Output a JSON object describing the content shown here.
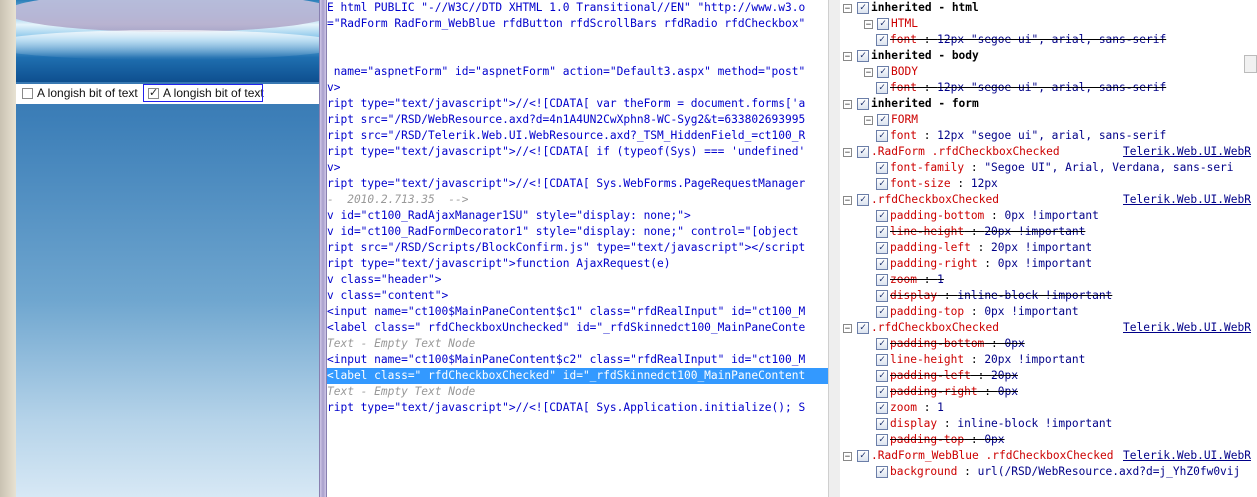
{
  "preview": {
    "checkbox1": {
      "label": "A longish bit of text",
      "checked": false
    },
    "checkbox2": {
      "label": "A longish bit of text",
      "checked": true
    }
  },
  "source_lines": [
    "E html PUBLIC \"-//W3C//DTD XHTML 1.0 Transitional//EN\" \"http://www.w3.o",
    "=\"RadForm RadForm_WebBlue rfdButton rfdScrollBars rfdRadio rfdCheckbox\"",
    "",
    "",
    " name=\"aspnetForm\" id=\"aspnetForm\" action=\"Default3.aspx\" method=\"post\"",
    "v>",
    "ript type=\"text/javascript\">//<![CDATA[ var theForm = document.forms['a",
    "ript src=\"/RSD/WebResource.axd?d=4n1A4UN2CwXphn8-WC-Syg2&t=633802693995",
    "ript src=\"/RSD/Telerik.Web.UI.WebResource.axd?_TSM_HiddenField_=ct100_R",
    "ript type=\"text/javascript\">//<![CDATA[ if (typeof(Sys) === 'undefined'",
    "v>",
    "ript type=\"text/javascript\">//<![CDATA[ Sys.WebForms.PageRequestManager",
    "-  2010.2.713.35  -->",
    "v id=\"ct100_RadAjaxManager1SU\" style=\"display: none;\">",
    "v id=\"ct100_RadFormDecorator1\" style=\"display: none;\" control=\"[object",
    "ript src=\"/RSD/Scripts/BlockConfirm.js\" type=\"text/javascript\"></script",
    "ript type=\"text/javascript\">function AjaxRequest(e)",
    "v class=\"header\">",
    "v class=\"content\">",
    "<input name=\"ct100$MainPaneContent$c1\" class=\"rfdRealInput\" id=\"ct100_M",
    "<label class=\" rfdCheckboxUnchecked\" id=\"_rfdSkinnedct100_MainPaneConte",
    "Text - Empty Text Node",
    "<input name=\"ct100$MainPaneContent$c2\" class=\"rfdRealInput\" id=\"ct100_M",
    "<label class=\" rfdCheckboxChecked\" id=\"_rfdSkinnedct100_MainPaneContent",
    "Text - Empty Text Node",
    "ript type=\"text/javascript\">//<![CDATA[ Sys.Application.initialize(); S"
  ],
  "styles": [
    {
      "kind": "group",
      "text": "inherited - html",
      "strike": false
    },
    {
      "kind": "selector",
      "text": "HTML"
    },
    {
      "kind": "prop",
      "name": "font",
      "value": "12px \"segoe ui\", arial, sans-serif",
      "strike": true
    },
    {
      "kind": "group",
      "text": "inherited - body"
    },
    {
      "kind": "selector",
      "text": "BODY"
    },
    {
      "kind": "prop",
      "name": "font",
      "value": "12px \"segoe ui\", arial, sans-serif",
      "strike": true
    },
    {
      "kind": "group",
      "text": "inherited - form"
    },
    {
      "kind": "selector",
      "text": "FORM"
    },
    {
      "kind": "prop",
      "name": "font",
      "value": "12px \"segoe ui\", arial, sans-serif",
      "strike": false
    },
    {
      "kind": "rule",
      "text": ".RadForm .rfdCheckboxChecked",
      "source": "Telerik.Web.UI.WebR"
    },
    {
      "kind": "prop",
      "name": "font-family",
      "value": "\"Segoe  UI\", Arial, Verdana, sans-seri",
      "strike": false
    },
    {
      "kind": "prop",
      "name": "font-size",
      "value": "12px",
      "strike": false
    },
    {
      "kind": "rule",
      "text": ".rfdCheckboxChecked",
      "source": "Telerik.Web.UI.WebR"
    },
    {
      "kind": "prop",
      "name": "padding-bottom",
      "value": "0px !important",
      "strike": false
    },
    {
      "kind": "prop",
      "name": "line-height",
      "value": "20px !important",
      "strike": true
    },
    {
      "kind": "prop",
      "name": "padding-left",
      "value": "20px !important",
      "strike": false
    },
    {
      "kind": "prop",
      "name": "padding-right",
      "value": "0px !important",
      "strike": false
    },
    {
      "kind": "prop",
      "name": "zoom",
      "value": "1",
      "strike": true
    },
    {
      "kind": "prop",
      "name": "display",
      "value": "inline-block !important",
      "strike": true
    },
    {
      "kind": "prop",
      "name": "padding-top",
      "value": "0px !important",
      "strike": false
    },
    {
      "kind": "rule",
      "text": ".rfdCheckboxChecked",
      "source": "Telerik.Web.UI.WebR"
    },
    {
      "kind": "prop",
      "name": "padding-bottom",
      "value": "0px",
      "strike": true
    },
    {
      "kind": "prop",
      "name": "line-height",
      "value": "20px !important",
      "strike": false
    },
    {
      "kind": "prop",
      "name": "padding-left",
      "value": "20px",
      "strike": true
    },
    {
      "kind": "prop",
      "name": "padding-right",
      "value": "0px",
      "strike": true
    },
    {
      "kind": "prop",
      "name": "zoom",
      "value": "1",
      "strike": false
    },
    {
      "kind": "prop",
      "name": "display",
      "value": "inline-block !important",
      "strike": false
    },
    {
      "kind": "prop",
      "name": "padding-top",
      "value": "0px",
      "strike": true
    },
    {
      "kind": "rule",
      "text": ".RadForm_WebBlue .rfdCheckboxChecked",
      "source": "Telerik.Web.UI.WebR"
    },
    {
      "kind": "prop",
      "name": "background",
      "value": "url(/RSD/WebResource.axd?d=j_YhZ0fw0vij",
      "strike": false
    }
  ]
}
